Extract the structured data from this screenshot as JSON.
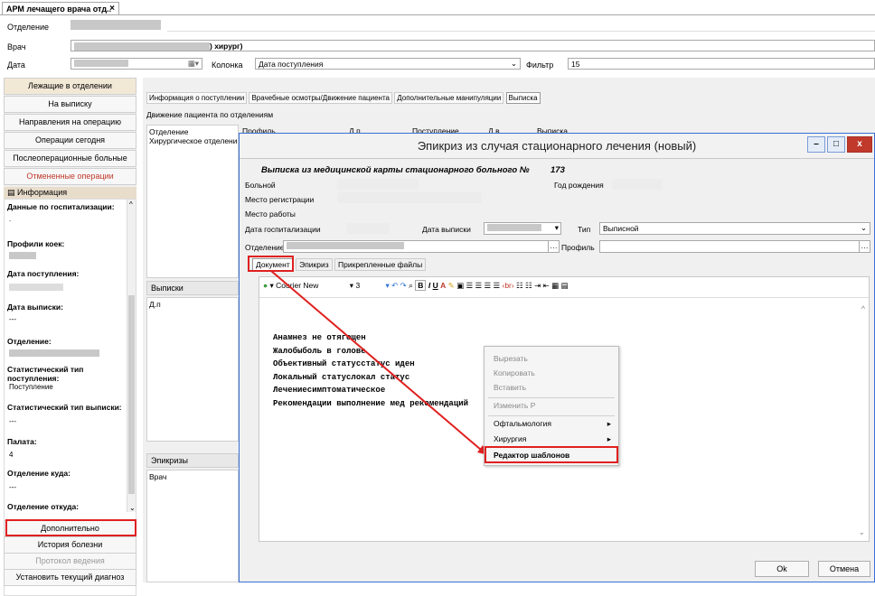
{
  "app": {
    "tab_label": "АРМ лечащего врача отд..",
    "tab_close": "×"
  },
  "top": {
    "department_label": "Отделение",
    "doctor_label": "Врач",
    "doctor_value_suffix": ") хирург)",
    "date_label": "Дата",
    "column_label": "Колонка",
    "column_value": "Дата поступления",
    "filter_label": "Фильтр",
    "filter_value": "15"
  },
  "left": {
    "buttons": [
      "Лежащие в отделении",
      "На выписку",
      "Направления на операцию",
      "Операции сегодня",
      "Послеоперационные больные",
      "Отмененные операции"
    ],
    "info_header": "Информация",
    "info": [
      {
        "k": "Данные по госпитализации:",
        "v": "."
      },
      {
        "k": "Профили коек:",
        "v": ""
      },
      {
        "k": "Дата поступления:",
        "v": ""
      },
      {
        "k": "Дата выписки:",
        "v": "---"
      },
      {
        "k": "Отделение:",
        "v": ""
      },
      {
        "k": "Статистический тип поступления:",
        "v": "Поступление"
      },
      {
        "k": "Статистический тип выписки:",
        "v": "---"
      },
      {
        "k": "Палата:",
        "v": "4"
      },
      {
        "k": "Отделение куда:",
        "v": "---"
      },
      {
        "k": "Отделение откуда:",
        "v": ""
      }
    ],
    "bottom_buttons": [
      "Дополнительно",
      "История болезни",
      "Протокол ведения",
      "Установить текущий диагноз"
    ]
  },
  "main": {
    "tabs": [
      "Информация о поступлении",
      "Врачебные осмотры/Движение пациента",
      "Дополнительные манипуляции",
      "Выписка"
    ],
    "movement_header": "Движение пациента по отделениям",
    "movement_columns": [
      "Отделение",
      "Профиль",
      "Д.п",
      "Поступление",
      "Д.в",
      "Выписка"
    ],
    "movement_row": "Хирургическое отделение",
    "discharges_header": "Выписки",
    "discharges_col": "Д.п",
    "epicrises_header": "Эпикризы",
    "epicrises_col": "Врач"
  },
  "dialog": {
    "title": "Эпикриз из случая стационарного лечения (новый)",
    "win_buttons": [
      "–",
      "□",
      "x"
    ],
    "heading": "Выписка из медицинской карты стационарного больного №",
    "number": "173",
    "patient_label": "Больной",
    "birth_label": "Год рождения",
    "reg_label": "Место регистрации",
    "work_label": "Место работы",
    "hosp_date_label": "Дата госпитализации",
    "discharge_date_label": "Дата выписки",
    "type_label": "Тип",
    "type_value": "Выписной",
    "dept_label": "Отделение",
    "profile_label": "Профиль",
    "tabs": [
      "Документ",
      "Эпикриз",
      "Прикрепленные файлы"
    ],
    "font_name": "Courier New",
    "font_size": "3",
    "lines": [
      "Анамнез  не отягощен",
      "Жалобыболь в голове",
      "Объективный статусстатус иден",
      "Локальный статуслокал статус",
      "Лечениесимптоматическое",
      "Рекомендации выполнение мед рекомендаций"
    ],
    "ok_label": "Ok",
    "cancel_label": "Отмена"
  },
  "context_menu": {
    "items": [
      {
        "label": "Вырезать",
        "disabled": true
      },
      {
        "label": "Копировать",
        "disabled": true
      },
      {
        "label": "Вставить",
        "disabled": true
      },
      {
        "label": "Изменить Р",
        "disabled": true
      },
      {
        "label": "Офтальмология",
        "disabled": false,
        "submenu": "▸"
      },
      {
        "label": "Хирургия",
        "disabled": false,
        "submenu": "▸"
      },
      {
        "label": "Редактор шаблонов",
        "disabled": false
      }
    ]
  },
  "colors": {
    "highlight": "#e02020",
    "titlebar_border": "#3a6fd8",
    "close_button": "#c0392b"
  }
}
